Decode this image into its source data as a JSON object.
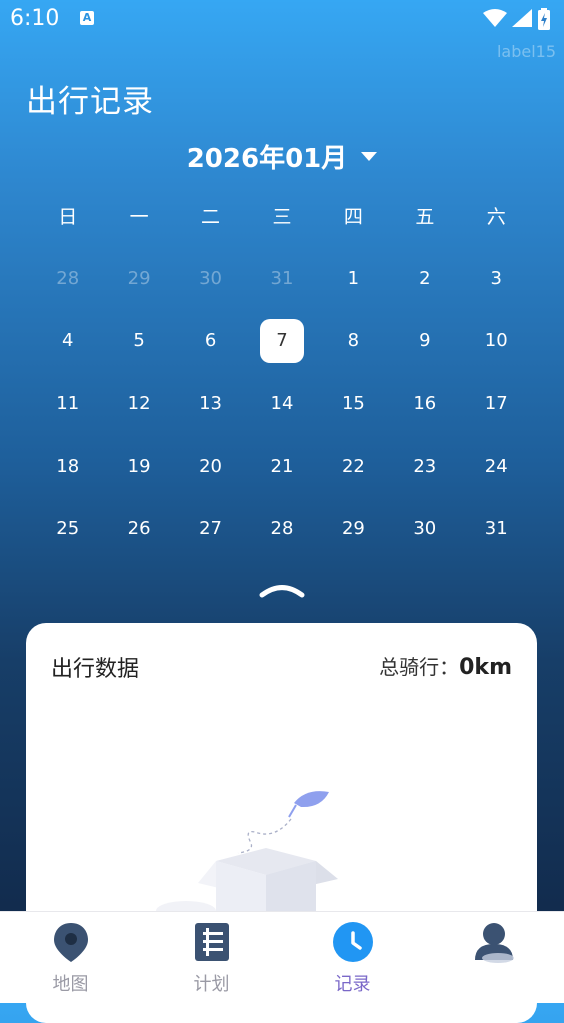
{
  "status_bar": {
    "time": "6:10",
    "notification_icon": "A",
    "icons": [
      "wifi-icon",
      "signal-icon",
      "battery-charging-icon"
    ]
  },
  "overlay_label": "label15",
  "header": {
    "title": "出行记录",
    "month": "2026年01月"
  },
  "calendar": {
    "weekdays": [
      "日",
      "一",
      "二",
      "三",
      "四",
      "五",
      "六"
    ],
    "weeks": [
      [
        {
          "d": "28",
          "muted": true
        },
        {
          "d": "29",
          "muted": true
        },
        {
          "d": "30",
          "muted": true
        },
        {
          "d": "31",
          "muted": true
        },
        {
          "d": "1"
        },
        {
          "d": "2"
        },
        {
          "d": "3"
        }
      ],
      [
        {
          "d": "4"
        },
        {
          "d": "5"
        },
        {
          "d": "6"
        },
        {
          "d": "7",
          "selected": true
        },
        {
          "d": "8"
        },
        {
          "d": "9"
        },
        {
          "d": "10"
        }
      ],
      [
        {
          "d": "11"
        },
        {
          "d": "12"
        },
        {
          "d": "13"
        },
        {
          "d": "14"
        },
        {
          "d": "15"
        },
        {
          "d": "16"
        },
        {
          "d": "17"
        }
      ],
      [
        {
          "d": "18"
        },
        {
          "d": "19"
        },
        {
          "d": "20"
        },
        {
          "d": "21"
        },
        {
          "d": "22"
        },
        {
          "d": "23"
        },
        {
          "d": "24"
        }
      ],
      [
        {
          "d": "25"
        },
        {
          "d": "26"
        },
        {
          "d": "27"
        },
        {
          "d": "28"
        },
        {
          "d": "29"
        },
        {
          "d": "30"
        },
        {
          "d": "31"
        }
      ]
    ]
  },
  "card": {
    "title": "出行数据",
    "total_label": "总骑行：",
    "total_value": "0km"
  },
  "nav": {
    "items": [
      {
        "label": "地图",
        "icon": "map-pin-icon",
        "active": false
      },
      {
        "label": "计划",
        "icon": "plan-list-icon",
        "active": false
      },
      {
        "label": "记录",
        "icon": "clock-icon",
        "active": true
      },
      {
        "label": "",
        "icon": "user-avatar-icon",
        "active": false
      }
    ]
  },
  "colors": {
    "accent": "#2196f3",
    "active_label": "#7a68c8",
    "inactive_label": "#9a9aa5",
    "nav_icon_dark": "#3b5272"
  }
}
